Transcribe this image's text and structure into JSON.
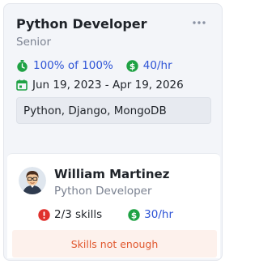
{
  "job": {
    "title": "Python Developer",
    "level": "Senior",
    "match": "100% of 100%",
    "rate": "40/hr",
    "dates": "Jun 19, 2023 - Apr 19, 2026",
    "skills": "Python, Django, MongoDB"
  },
  "candidate": {
    "name": "William Martinez",
    "role": "Python Developer",
    "skills_match": "2/3 skills",
    "rate": "30/hr",
    "warning": "Skills not enough"
  },
  "icons": {
    "more": "more-horizontal-icon",
    "match": "stopwatch-icon",
    "rate": "dollar-circle-icon",
    "dates": "calendar-icon",
    "skills_alert": "alert-circle-icon"
  },
  "colors": {
    "green": "#1fa244",
    "blue": "#2e54d6",
    "red": "#e0312d",
    "warning_text": "#e0572d",
    "warning_bg": "#fdf1ec"
  }
}
